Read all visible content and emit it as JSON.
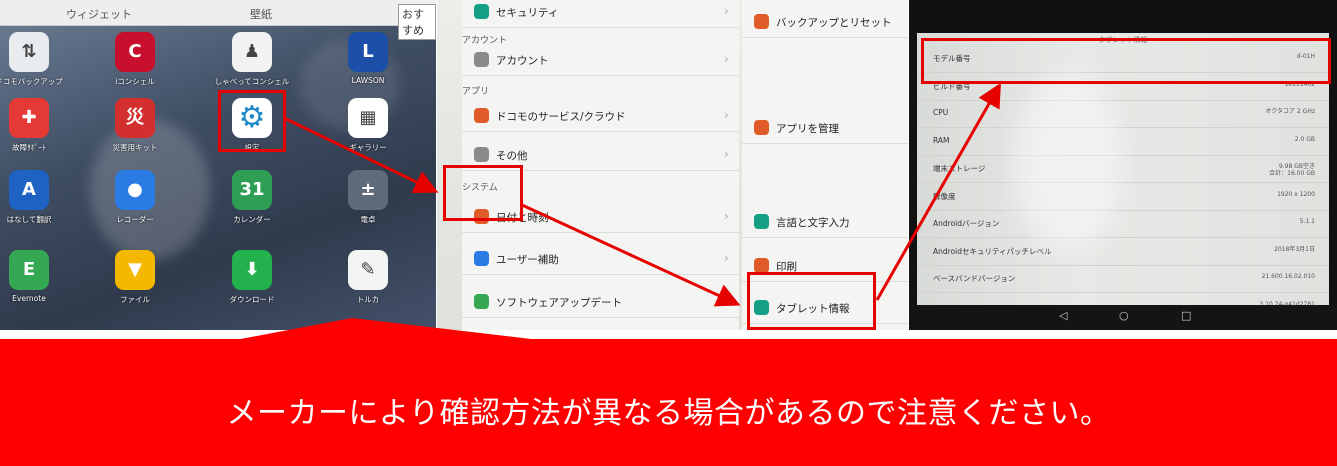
{
  "home_screen": {
    "tabs": [
      "ウィジェット",
      "壁紙",
      "おすすめ"
    ],
    "apps": [
      {
        "label": "ドコモバックアップ",
        "icon": "backup-icon",
        "color": "#e9ecef",
        "glyph": "⇅"
      },
      {
        "label": "iコンシェル",
        "icon": "iconcier-icon",
        "color": "#c8102e",
        "glyph": "C"
      },
      {
        "label": "しゃべってコンシェル",
        "icon": "concier-icon",
        "color": "#f2f2f2",
        "glyph": "♟"
      },
      {
        "label": "LAWSON",
        "icon": "lawson-icon",
        "color": "#1c4fa8",
        "glyph": "L"
      },
      {
        "label": "故障ｻﾎﾟｰﾄ",
        "icon": "support-icon",
        "color": "#e53935",
        "glyph": "✚"
      },
      {
        "label": "災害用キット",
        "icon": "disaster-kit-icon",
        "color": "#d32f2f",
        "glyph": "災"
      },
      {
        "label": "設定",
        "icon": "gear-icon",
        "color": "#ffffff",
        "glyph": "⚙"
      },
      {
        "label": "ギャラリー",
        "icon": "gallery-icon",
        "color": "#ffffff",
        "glyph": "▦"
      },
      {
        "label": "はなして翻訳",
        "icon": "translate-icon",
        "color": "#1e63c4",
        "glyph": "A"
      },
      {
        "label": "レコーダー",
        "icon": "recorder-icon",
        "color": "#2a7be4",
        "glyph": "●"
      },
      {
        "label": "カレンダー",
        "icon": "calendar-icon",
        "color": "#2e9e55",
        "glyph": "31"
      },
      {
        "label": "電卓",
        "icon": "calculator-icon",
        "color": "#5f6b78",
        "glyph": "±"
      },
      {
        "label": "Evernote",
        "icon": "evernote-icon",
        "color": "#34a853",
        "glyph": "E"
      },
      {
        "label": "ファイル",
        "icon": "file-icon",
        "color": "#f5b800",
        "glyph": "▼"
      },
      {
        "label": "ダウンロード",
        "icon": "download-icon",
        "color": "#22b14c",
        "glyph": "⬇"
      },
      {
        "label": "トルカ",
        "icon": "toruca-icon",
        "color": "#f4f4f4",
        "glyph": "✎"
      }
    ]
  },
  "settings": {
    "left_column": [
      {
        "type": "row",
        "label": "セキュリティ",
        "icon": "shield-icon",
        "color": "#14a085"
      },
      {
        "type": "section",
        "label": "アカウント"
      },
      {
        "type": "row",
        "label": "アカウント",
        "icon": "account-icon",
        "color": "#8a8a8a"
      },
      {
        "type": "section",
        "label": "アプリ"
      },
      {
        "type": "row",
        "label": "ドコモのサービス/クラウド",
        "icon": "docomo-service-icon",
        "color": "#e05b28"
      },
      {
        "type": "row",
        "label": "その他",
        "icon": "more-icon",
        "color": "#8a8a8a"
      },
      {
        "type": "section",
        "label": "システム"
      },
      {
        "type": "row",
        "label": "日付と時刻",
        "icon": "clock-icon",
        "color": "#e05b28"
      },
      {
        "type": "row",
        "label": "ユーザー補助",
        "icon": "accessibility-icon",
        "color": "#2a7be4"
      },
      {
        "type": "row",
        "label": "ソフトウェアアップデート",
        "icon": "update-icon",
        "color": "#34a853"
      }
    ],
    "right_column": [
      {
        "label": "バックアップとリセット",
        "icon": "backup-reset-icon",
        "color": "#e05b28"
      },
      {
        "label": "アプリを管理",
        "icon": "apps-icon",
        "color": "#e05b28"
      },
      {
        "label": "言語と文字入力",
        "icon": "language-icon",
        "color": "#14a085"
      },
      {
        "label": "印刷",
        "icon": "print-icon",
        "color": "#e05b28"
      },
      {
        "label": "タブレット情報",
        "icon": "tablet-icon",
        "color": "#14a085"
      }
    ]
  },
  "tablet_info": {
    "title": "タブレット情報",
    "rows": [
      {
        "key": "モデル番号",
        "value": "d-01H"
      },
      {
        "key": "ビルド番号",
        "value": "18111402"
      },
      {
        "key": "CPU",
        "value": "オクタコア 2 GHz"
      },
      {
        "key": "RAM",
        "value": "2.0 GB"
      },
      {
        "key": "端末ストレージ",
        "value": "9.98 GB空き\n合計：16.00 GB"
      },
      {
        "key": "解像度",
        "value": "1920 x 1200"
      },
      {
        "key": "Androidバージョン",
        "value": "5.1.1"
      },
      {
        "key": "Androidセキュリティパッチレベル",
        "value": "2018年3月1日"
      },
      {
        "key": "ベースバンドバージョン",
        "value": "21.600.16.02.010"
      },
      {
        "key": "",
        "value": "3.10.74-g41d2781"
      }
    ],
    "nav": [
      "◁",
      "○",
      "□"
    ]
  },
  "banner": {
    "text": "メーカーにより確認方法が異なる場合があるので注意ください。",
    "color": "#ff0000"
  }
}
